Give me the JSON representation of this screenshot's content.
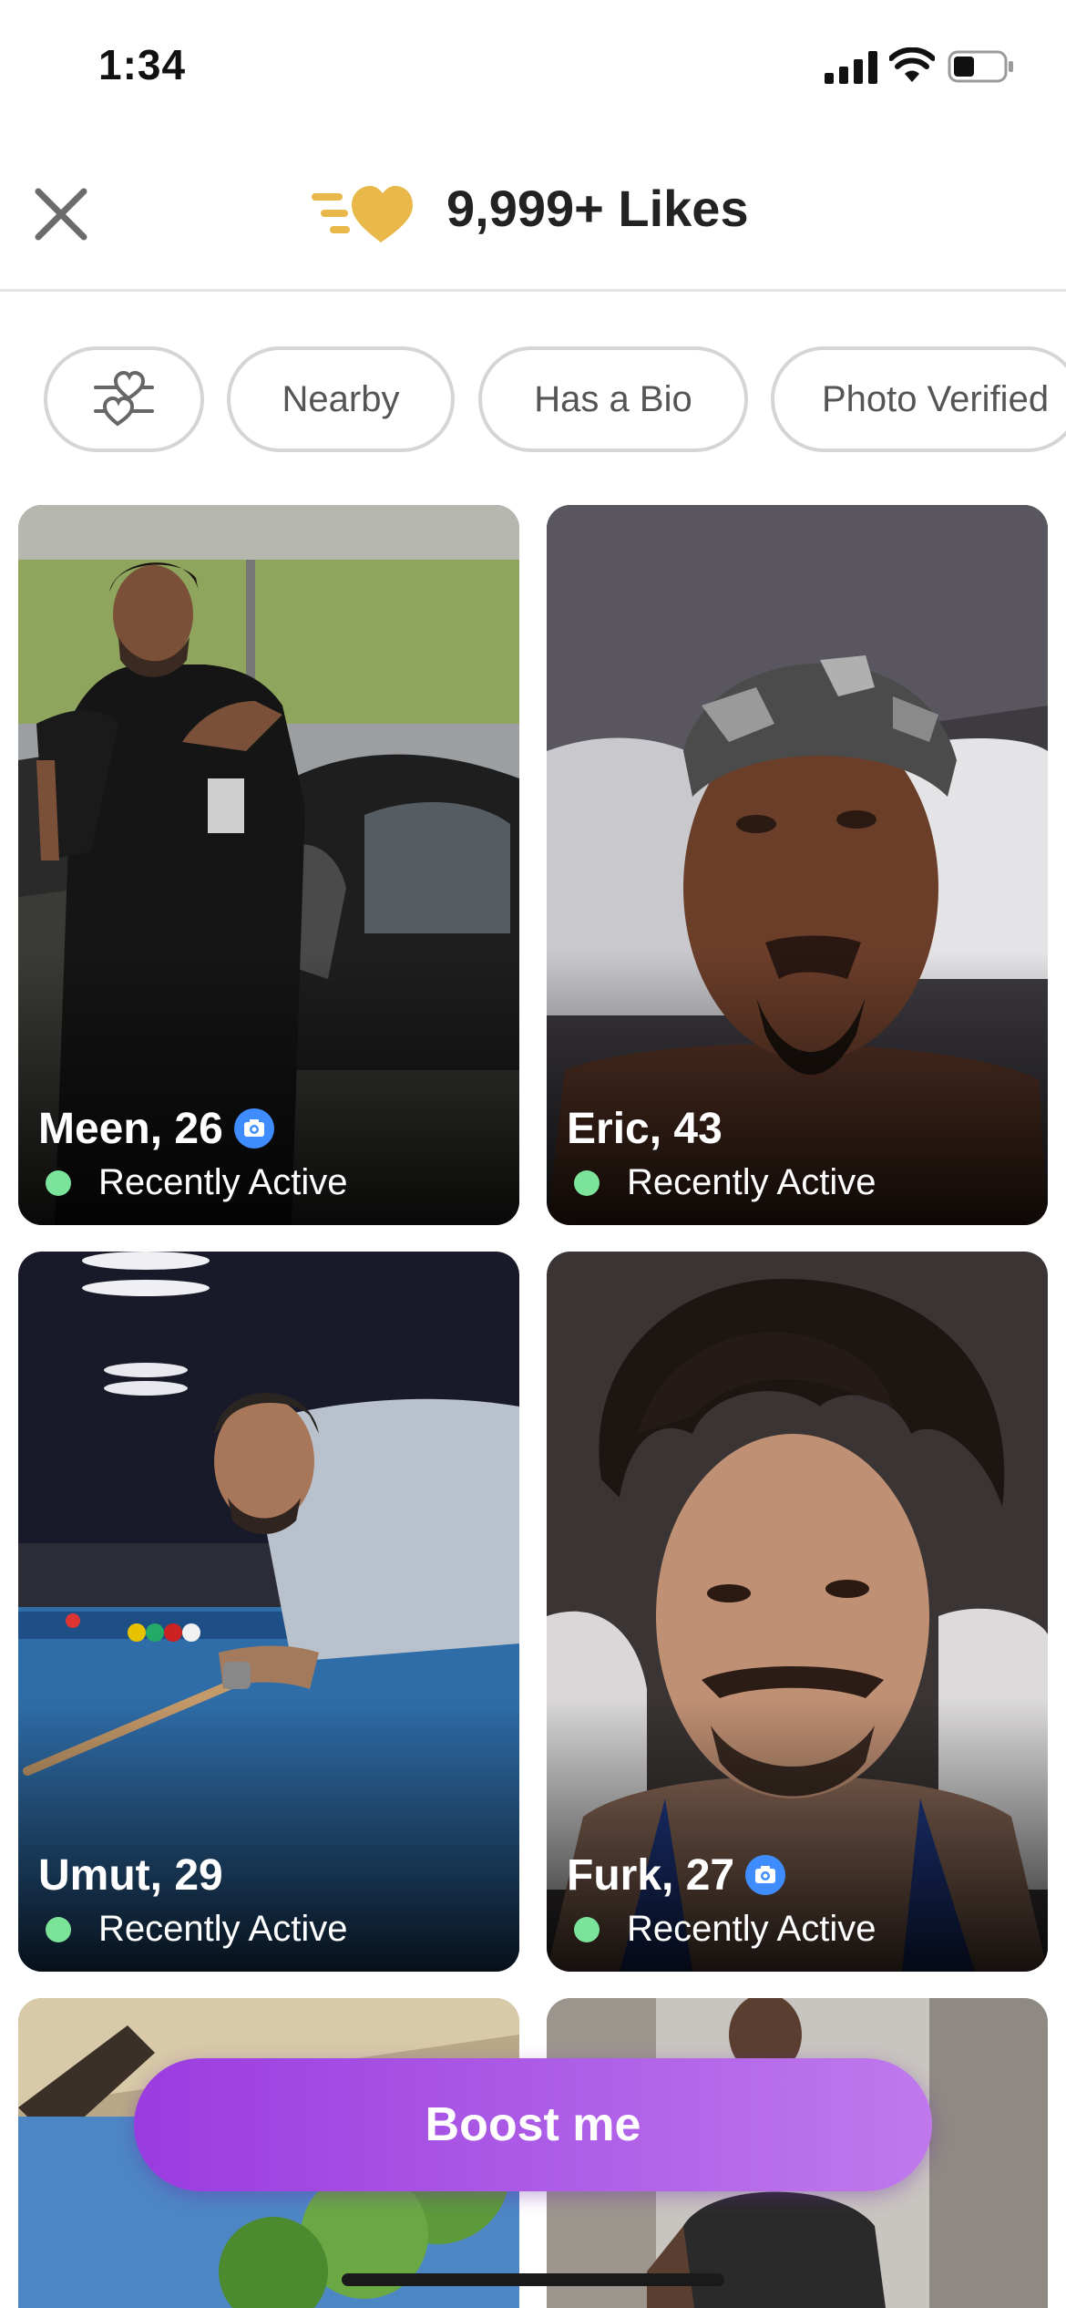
{
  "status_bar": {
    "time": "1:34"
  },
  "header": {
    "title": "9,999+ Likes"
  },
  "filters": [
    {
      "label": "Nearby"
    },
    {
      "label": "Has a Bio"
    },
    {
      "label": "Photo Verified"
    }
  ],
  "cards": [
    {
      "name": "Meen, 26",
      "verified": true,
      "status": "Recently Active"
    },
    {
      "name": "Eric, 43",
      "verified": false,
      "status": "Recently Active"
    },
    {
      "name": "Umut, 29",
      "verified": false,
      "status": "Recently Active"
    },
    {
      "name": "Furk, 27",
      "verified": true,
      "status": "Recently Active"
    }
  ],
  "boost": {
    "label": "Boost me"
  },
  "colors": {
    "accent_purple": "#a64ee6",
    "like_gold": "#e8b84a",
    "active_green": "#7ce39a",
    "verify_blue": "#3f8cff"
  }
}
